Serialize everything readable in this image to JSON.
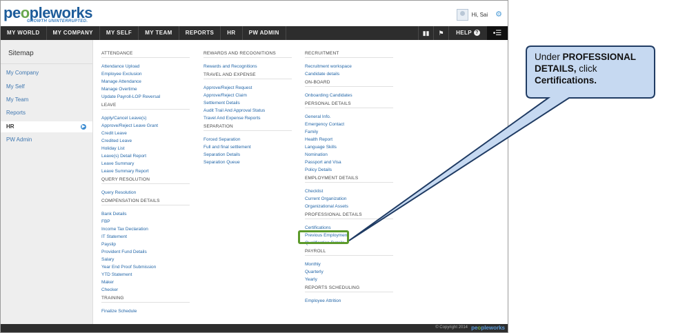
{
  "header": {
    "logo_text_a": "pe",
    "logo_text_o": "o",
    "logo_text_b": "pleworks",
    "logo_tagline": "GROWTH UNINTERRUPTED.",
    "greeting": "Hi, Sai",
    "settings_icon": "gear-icon"
  },
  "nav": {
    "items": [
      "MY WORLD",
      "MY COMPANY",
      "MY SELF",
      "MY TEAM",
      "REPORTS",
      "HR",
      "PW ADMIN"
    ],
    "help_label": "HELP",
    "icons": [
      "book-icon",
      "flag-icon",
      "help-icon",
      "menu-toggle-icon"
    ]
  },
  "sidebar": {
    "title": "Sitemap",
    "items": [
      "My Company",
      "My Self",
      "My Team",
      "Reports",
      "HR",
      "PW Admin"
    ],
    "active": "HR"
  },
  "sitemap": {
    "col1": {
      "groups": [
        {
          "heading": "ATTENDANCE",
          "links": [
            "Attendance Upload",
            "Employee Exclusion",
            "Manage Attendance",
            "Manage Overtime",
            "Update Payroll-LOP Reversal"
          ]
        },
        {
          "heading": "LEAVE",
          "links": [
            "Apply/Cancel Leave(s)",
            "Approve/Reject Leave Grant",
            "Credit Leave",
            "Credited Leave",
            "Holiday List",
            "Leave(s) Detail Report",
            "Leave Summary",
            "Leave Summary Report"
          ]
        },
        {
          "heading": "QUERY RESOLUTION",
          "links": [
            "Query Resolution"
          ]
        },
        {
          "heading": "COMPENSATION DETAILS",
          "links": [
            "Bank Details",
            "FBP",
            "Income Tax Declaration",
            "IT Statement",
            "Payslip",
            "Provident Fund Details",
            "Salary",
            "Year End Proof Submission",
            "YTD Statement",
            "Maker",
            "Checker"
          ]
        },
        {
          "heading": "TRAINING",
          "links": [
            "Finalize Schedule"
          ]
        }
      ]
    },
    "col2": {
      "groups": [
        {
          "heading": "REWARDS AND RECOGNITIONS",
          "links": [
            "Rewards and Recognitions"
          ]
        },
        {
          "heading": "TRAVEL AND EXPENSE",
          "links": [
            "Approve/Reject Request",
            "Approve/Reject Claim",
            "Settlement Details",
            "Audit Trail And Approval Status",
            "Travel And Expense Reports"
          ]
        },
        {
          "heading": "SEPARATION",
          "links": [
            "Forced Separation",
            "Full and final settlement",
            "Separation Details",
            "Separation Queue"
          ]
        }
      ]
    },
    "col3": {
      "groups": [
        {
          "heading": "RECRUITMENT",
          "links": [
            "Recruitment workspace",
            "Candidate details"
          ]
        },
        {
          "heading": "ON-BOARD",
          "links": [
            "Onboarding Candidates"
          ]
        },
        {
          "heading": "PERSONAL DETAILS",
          "links": [
            "General Info.",
            "Emergency Contact",
            "Family",
            "Health Report",
            "Language Skills",
            "Nomination",
            "Passport and Visa",
            "Policy Details"
          ]
        },
        {
          "heading": "EMPLOYMENT DETAILS",
          "links": [
            "Checklist",
            "Current Organization",
            "Organizational Assets"
          ]
        },
        {
          "heading": "PROFESSIONAL DETAILS",
          "links": [
            "Certifications",
            "Previous Employment",
            "Qualification Details"
          ]
        },
        {
          "heading": "PAYROLL",
          "links": [
            "Monthly",
            "Quarterly",
            "Yearly"
          ]
        },
        {
          "heading": "REPORTS SCHEDULING",
          "links": [
            "Employee Attrition"
          ]
        }
      ]
    }
  },
  "footer": {
    "copyright": "© Copyright 2014",
    "logo_text_a": "pe",
    "logo_text_o": "o",
    "logo_text_b": "pleworks"
  },
  "callout": {
    "text_1": "Under ",
    "text_2": "PROFESSIONAL DETAILS,",
    "text_3": " click ",
    "text_4": "Certifications."
  },
  "colors": {
    "nav_bg": "#2d2d2d",
    "link": "#2467a8",
    "highlight": "#5c9a2b",
    "callout_fill": "#c6d9f1"
  }
}
